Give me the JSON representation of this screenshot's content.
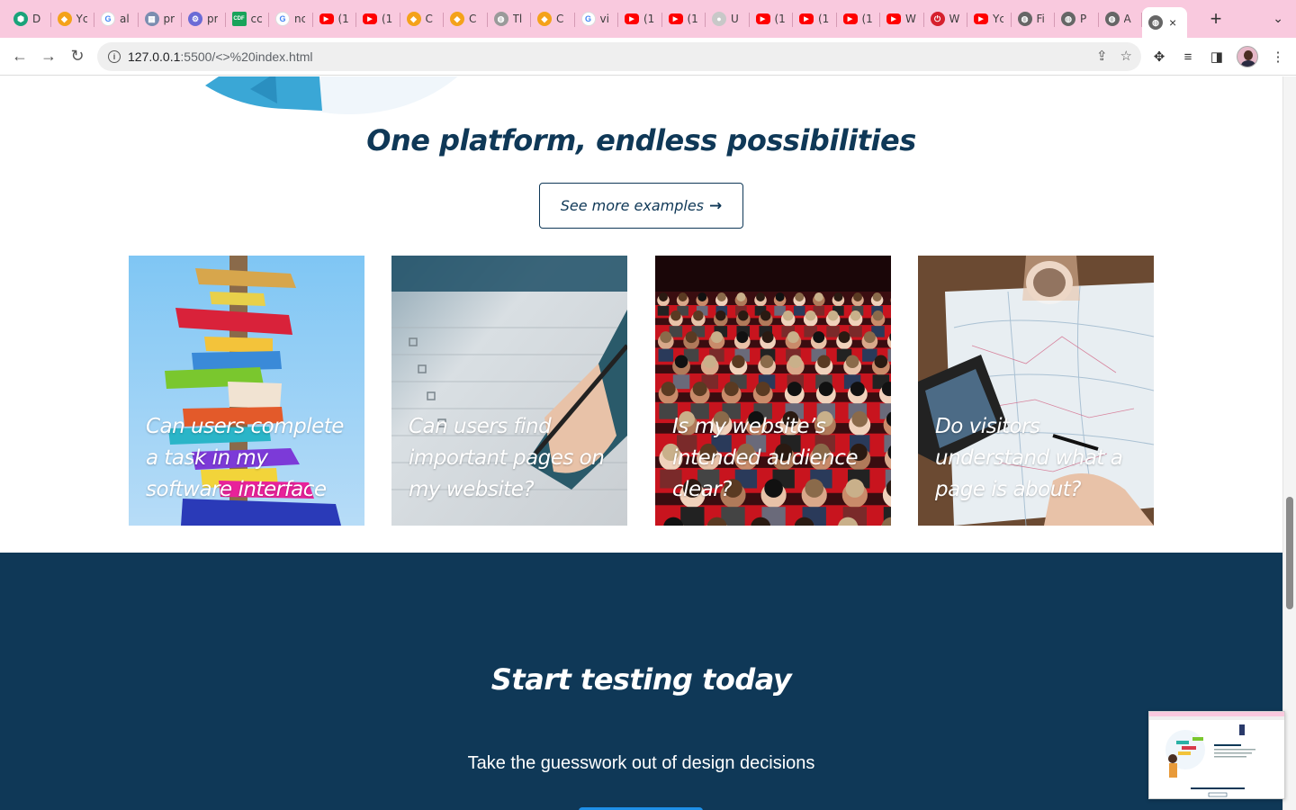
{
  "browser": {
    "tabs": [
      {
        "title": "D",
        "icon": "shield-icon",
        "color": "#1aa37a"
      },
      {
        "title": "Yc",
        "icon": "colorful-logo-icon",
        "color": "#f4a21a"
      },
      {
        "title": "al",
        "icon": "google-icon",
        "color": "#4285f4"
      },
      {
        "title": "pr",
        "icon": "thumbnail-icon",
        "color": "#7b8db0"
      },
      {
        "title": "pr",
        "icon": "robot-icon",
        "color": "#6b6bd6"
      },
      {
        "title": "cc",
        "icon": "cdf-icon",
        "color": "#19a35a"
      },
      {
        "title": "nc",
        "icon": "google-icon",
        "color": "#4285f4"
      },
      {
        "title": "(1",
        "icon": "youtube-icon",
        "color": "#ff0000"
      },
      {
        "title": "(1",
        "icon": "youtube-icon",
        "color": "#ff0000"
      },
      {
        "title": "C",
        "icon": "colorful-logo-icon",
        "color": "#f4a21a"
      },
      {
        "title": "C",
        "icon": "colorful-logo-icon",
        "color": "#f4a21a"
      },
      {
        "title": "Tl",
        "icon": "globe-icon",
        "color": "#9a9a9a"
      },
      {
        "title": "C",
        "icon": "colorful-logo-icon",
        "color": "#f4a21a"
      },
      {
        "title": "vi",
        "icon": "google-icon",
        "color": "#4285f4"
      },
      {
        "title": "(1",
        "icon": "youtube-icon",
        "color": "#ff0000"
      },
      {
        "title": "(1",
        "icon": "youtube-icon",
        "color": "#ff0000"
      },
      {
        "title": "U",
        "icon": "github-icon",
        "color": "#c8c8c8"
      },
      {
        "title": "(1",
        "icon": "youtube-icon",
        "color": "#ff0000"
      },
      {
        "title": "(1",
        "icon": "youtube-icon",
        "color": "#ff0000"
      },
      {
        "title": "(1",
        "icon": "youtube-icon",
        "color": "#ff0000"
      },
      {
        "title": "W",
        "icon": "youtube-icon",
        "color": "#ff0000"
      },
      {
        "title": "W",
        "icon": "power-icon",
        "color": "#d6202d"
      },
      {
        "title": "Yc",
        "icon": "youtube-icon",
        "color": "#ff0000"
      },
      {
        "title": "Fi",
        "icon": "globe-icon",
        "color": "#666666"
      },
      {
        "title": "P",
        "icon": "globe-icon",
        "color": "#666666"
      },
      {
        "title": "A",
        "icon": "globe-icon",
        "color": "#666666"
      }
    ],
    "active_tab": {
      "icon": "globe-icon",
      "close": "×"
    },
    "new_tab": "+",
    "tab_menu": "⌄",
    "url_host": "127.0.0.1",
    "url_path": ":5500/<>%20index.html"
  },
  "section": {
    "headline": "One platform, endless possibilities",
    "button_label": "See more examples",
    "button_arrow": "→",
    "cards": [
      {
        "caption": "Can users complete a task in my software interface",
        "image": "signpost-photo"
      },
      {
        "caption": "Can users find important pages on my website?",
        "image": "checklist-photo"
      },
      {
        "caption": "Is my website’s intended audience clear?",
        "image": "audience-photo"
      },
      {
        "caption": "Do visitors understand what a page is about?",
        "image": "map-photo"
      }
    ]
  },
  "cta": {
    "title": "Start testing today",
    "subtitle": "Take the guesswork out of design decisions"
  },
  "colors": {
    "navy": "#0f3857",
    "accent_blue": "#1e90e8",
    "tab_strip": "#f9c9de"
  }
}
